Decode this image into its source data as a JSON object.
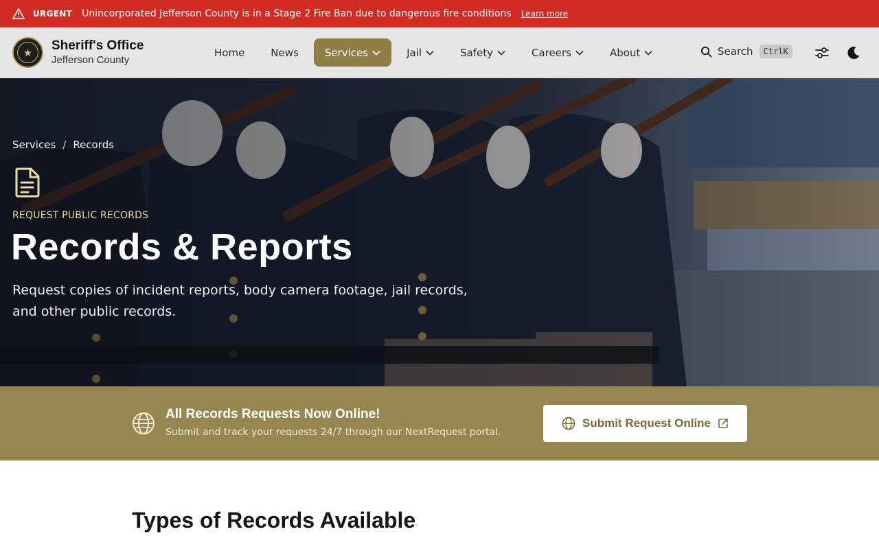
{
  "alert": {
    "label": "URGENT",
    "message": "Unincorporated Jefferson County is in a Stage 2 Fire Ban due to dangerous fire conditions",
    "link": "Learn more",
    "color": "#d12b24"
  },
  "brand": {
    "title": "Sheriff's Office",
    "subtitle": "Jefferson County"
  },
  "nav": {
    "items": [
      {
        "label": "Home"
      },
      {
        "label": "News"
      },
      {
        "label": "Services"
      },
      {
        "label": "Jail"
      },
      {
        "label": "Safety"
      },
      {
        "label": "Careers"
      },
      {
        "label": "About"
      }
    ],
    "active": "Services",
    "accent": "#8f7f45"
  },
  "search": {
    "label": "Search",
    "shortcut": "CtrlK"
  },
  "hero": {
    "breadcrumb": [
      "Services",
      "Records"
    ],
    "eyebrow": "REQUEST PUBLIC RECORDS",
    "title": "Records & Reports",
    "description": "Request copies of incident reports, body camera footage, jail records, and other public records."
  },
  "banner": {
    "title": "All Records Requests Now Online!",
    "subtitle": "Submit and track your requests 24/7 through our NextRequest portal.",
    "button": "Submit Request Online",
    "color": "#968751"
  },
  "section": {
    "title": "Types of Records Available"
  },
  "icons": {
    "alert": "warning-icon",
    "search": "search-icon",
    "settings": "sliders-icon",
    "theme": "moon-icon",
    "document": "document-icon",
    "globe": "globe-icon",
    "external": "external-link-icon"
  }
}
